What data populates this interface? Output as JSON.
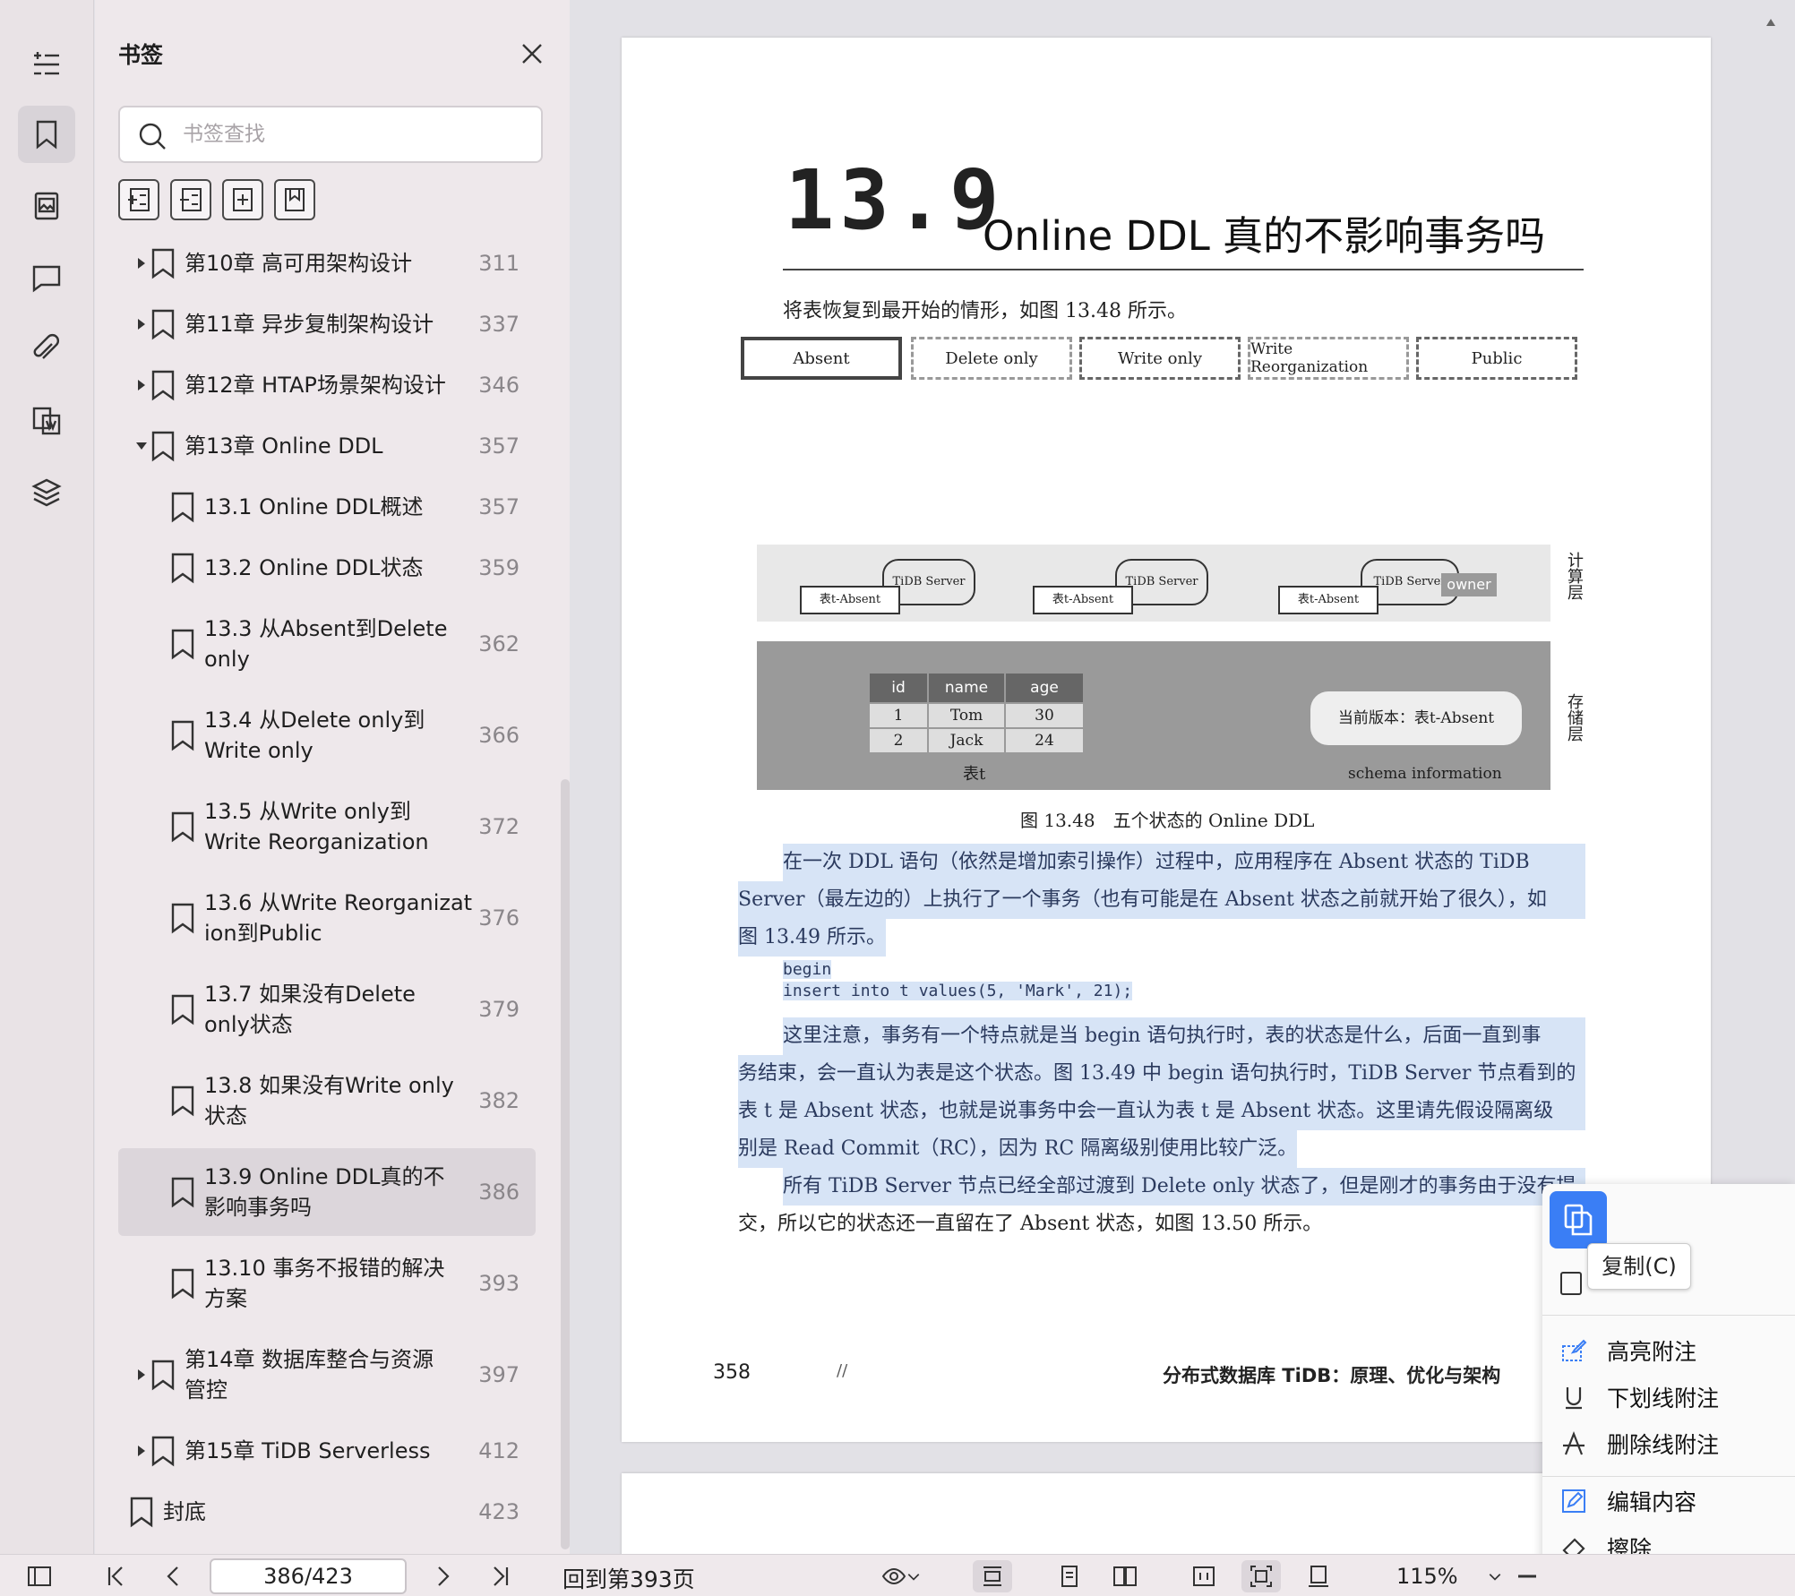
{
  "sidebar": {
    "title": "书签",
    "search_placeholder": "书签查找",
    "items": [
      {
        "label": "第10章 高可用架构设计",
        "page": "311",
        "level": 0,
        "arrow": "right"
      },
      {
        "label": "第11章 异步复制架构设计",
        "page": "337",
        "level": 0,
        "arrow": "right"
      },
      {
        "label": "第12章 HTAP场景架构设计",
        "page": "346",
        "level": 0,
        "arrow": "right"
      },
      {
        "label": "第13章 Online DDL",
        "page": "357",
        "level": 0,
        "arrow": "down"
      },
      {
        "label": "13.1 Online DDL概述",
        "page": "357",
        "level": 1
      },
      {
        "label": "13.2 Online DDL状态",
        "page": "359",
        "level": 1
      },
      {
        "label": "13.3 从Absent到Delete only",
        "page": "362",
        "level": 1
      },
      {
        "label": "13.4 从Delete only到Write only",
        "page": "366",
        "level": 1
      },
      {
        "label": "13.5 从Write only到Write Reorganization",
        "page": "372",
        "level": 1
      },
      {
        "label": "13.6 从Write Reorganization到Public",
        "page": "376",
        "level": 1
      },
      {
        "label": "13.7 如果没有Delete only状态",
        "page": "379",
        "level": 1
      },
      {
        "label": "13.8 如果没有Write only状态",
        "page": "382",
        "level": 1
      },
      {
        "label": "13.9 Online DDL真的不影响事务吗",
        "page": "386",
        "level": 1,
        "selected": true
      },
      {
        "label": "13.10 事务不报错的解决方案",
        "page": "393",
        "level": 1
      },
      {
        "label": "第14章 数据库整合与资源管控",
        "page": "397",
        "level": 0,
        "arrow": "right"
      },
      {
        "label": "第15章 TiDB Serverless",
        "page": "412",
        "level": 0,
        "arrow": "right"
      },
      {
        "label": "封底",
        "page": "423",
        "level": -1
      }
    ]
  },
  "page": {
    "chapter_number": "13.9",
    "chapter_title": "Online DDL 真的不影响事务吗",
    "intro": "将表恢复到最开始的情形，如图 13.48 所示。",
    "states": [
      "Absent",
      "Delete only",
      "Write only",
      "Write Reorganization",
      "Public"
    ],
    "diagram": {
      "server_label": "TiDB Server",
      "table_label": "表t-Absent",
      "owner_label": "owner",
      "compute_layer": "计算层",
      "storage_layer": "存储层",
      "table": {
        "headers": [
          "id",
          "name",
          "age"
        ],
        "rows": [
          [
            "1",
            "Tom",
            "30"
          ],
          [
            "2",
            "Jack",
            "24"
          ]
        ],
        "caption": "表t"
      },
      "version": "当前版本：表t-Absent",
      "schema": "schema information"
    },
    "figure_caption": "图 13.48　五个状态的 Online DDL",
    "para1": [
      "在一次 DDL 语句（依然是增加索引操作）过程中，应用程序在 Absent 状态的 TiDB",
      "Server（最左边的）上执行了一个事务（也有可能是在 Absent 状态之前就开始了很久），如",
      "图 13.49 所示。"
    ],
    "code": [
      "begin",
      "insert into t values(5, 'Mark', 21);"
    ],
    "para2": [
      "这里注意，事务有一个特点就是当 begin 语句执行时，表的状态是什么，后面一直到事",
      "务结束，会一直认为表是这个状态。图 13.49 中 begin 语句执行时，TiDB Server 节点看到的",
      "表 t 是 Absent 状态，也就是说事务中会一直认为表 t 是 Absent 状态。这里请先假设隔离级",
      "别是 Read Commit（RC），因为 RC 隔离级别使用比较广泛。"
    ],
    "para3": [
      "所有 TiDB Server 节点已经全部过渡到 Delete only 状态了，但是刚才的事务由于没有提",
      "交，所以它的状态还一直留在了 Absent 状态，如图 13.50 所示。"
    ],
    "footer_page": "358",
    "footer_sep": "//",
    "footer_book": "分布式数据库 TiDB：原理、优化与架构"
  },
  "context_menu": {
    "copy_tooltip": "复制(C)",
    "items": [
      "高亮附注",
      "下划线附注",
      "删除线附注",
      "编辑内容",
      "擦除"
    ]
  },
  "bottom_bar": {
    "page_indicator": "386/423",
    "goto_label": "回到第393页",
    "zoom": "115%"
  },
  "colors": {
    "accent": "#3a7ef5",
    "highlight": "#d7e4f6",
    "selected_item": "#dcd6db"
  }
}
